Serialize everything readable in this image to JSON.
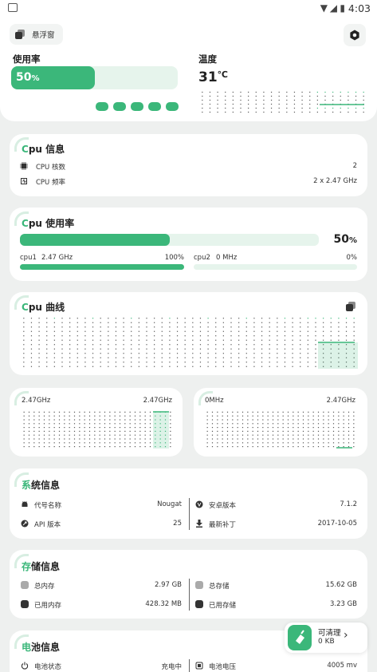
{
  "status_bar": {
    "time": "4:03"
  },
  "header": {
    "float_window_label": "悬浮窗"
  },
  "overview": {
    "usage_label": "使用率",
    "usage_value": "50",
    "usage_unit": "%",
    "usage_fraction": 0.5,
    "temp_label": "温度",
    "temp_value": "31",
    "temp_unit": "℃"
  },
  "cpu_info": {
    "title_accent": "C",
    "title_rest": "pu 信息",
    "rows": [
      {
        "label": "CPU 核数",
        "value": "2"
      },
      {
        "label": "CPU 频率",
        "value": "2 x 2.47 GHz"
      }
    ]
  },
  "cpu_usage": {
    "title_accent": "C",
    "title_rest": "pu 使用率",
    "total_value": "50",
    "total_unit": "%",
    "total_fraction": 0.5,
    "cores": [
      {
        "name": "cpu1",
        "freq": "2.47 GHz",
        "percent": "100%",
        "fraction": 1.0
      },
      {
        "name": "cpu2",
        "freq": "0 MHz",
        "percent": "0%",
        "fraction": 0.0
      }
    ]
  },
  "cpu_curve": {
    "title_accent": "C",
    "title_rest": "pu 曲线"
  },
  "core_graphs": [
    {
      "min_label": "2.47GHz",
      "max_label": "2.47GHz"
    },
    {
      "min_label": "0MHz",
      "max_label": "2.47GHz"
    }
  ],
  "system_info": {
    "title_accent": "系",
    "title_rest": "统信息",
    "left": [
      {
        "icon": "android-icon",
        "label": "代号名称",
        "value": "Nougat"
      },
      {
        "icon": "api-icon",
        "label": "API 版本",
        "value": "25"
      }
    ],
    "right": [
      {
        "icon": "version-icon",
        "label": "安卓版本",
        "value": "7.1.2"
      },
      {
        "icon": "patch-icon",
        "label": "最新补丁",
        "value": "2017-10-05"
      }
    ]
  },
  "storage_info": {
    "title_accent": "存",
    "title_rest": "储信息",
    "left": [
      {
        "label": "总内存",
        "value": "2.97 GB"
      },
      {
        "label": "已用内存",
        "value": "428.32 MB"
      }
    ],
    "right": [
      {
        "label": "总存储",
        "value": "15.62 GB"
      },
      {
        "label": "已用存储",
        "value": "3.23 GB"
      }
    ]
  },
  "battery_info": {
    "title_accent": "电",
    "title_rest": "池信息",
    "left": [
      {
        "label": "电池状态",
        "value": "充电中"
      }
    ],
    "right": [
      {
        "label": "电池电压",
        "value": "4005 mv"
      }
    ]
  },
  "clean_widget": {
    "title": "可清理",
    "value": "0 KB"
  },
  "colors": {
    "accent": "#3bb77a",
    "track": "#e6f4ec"
  }
}
